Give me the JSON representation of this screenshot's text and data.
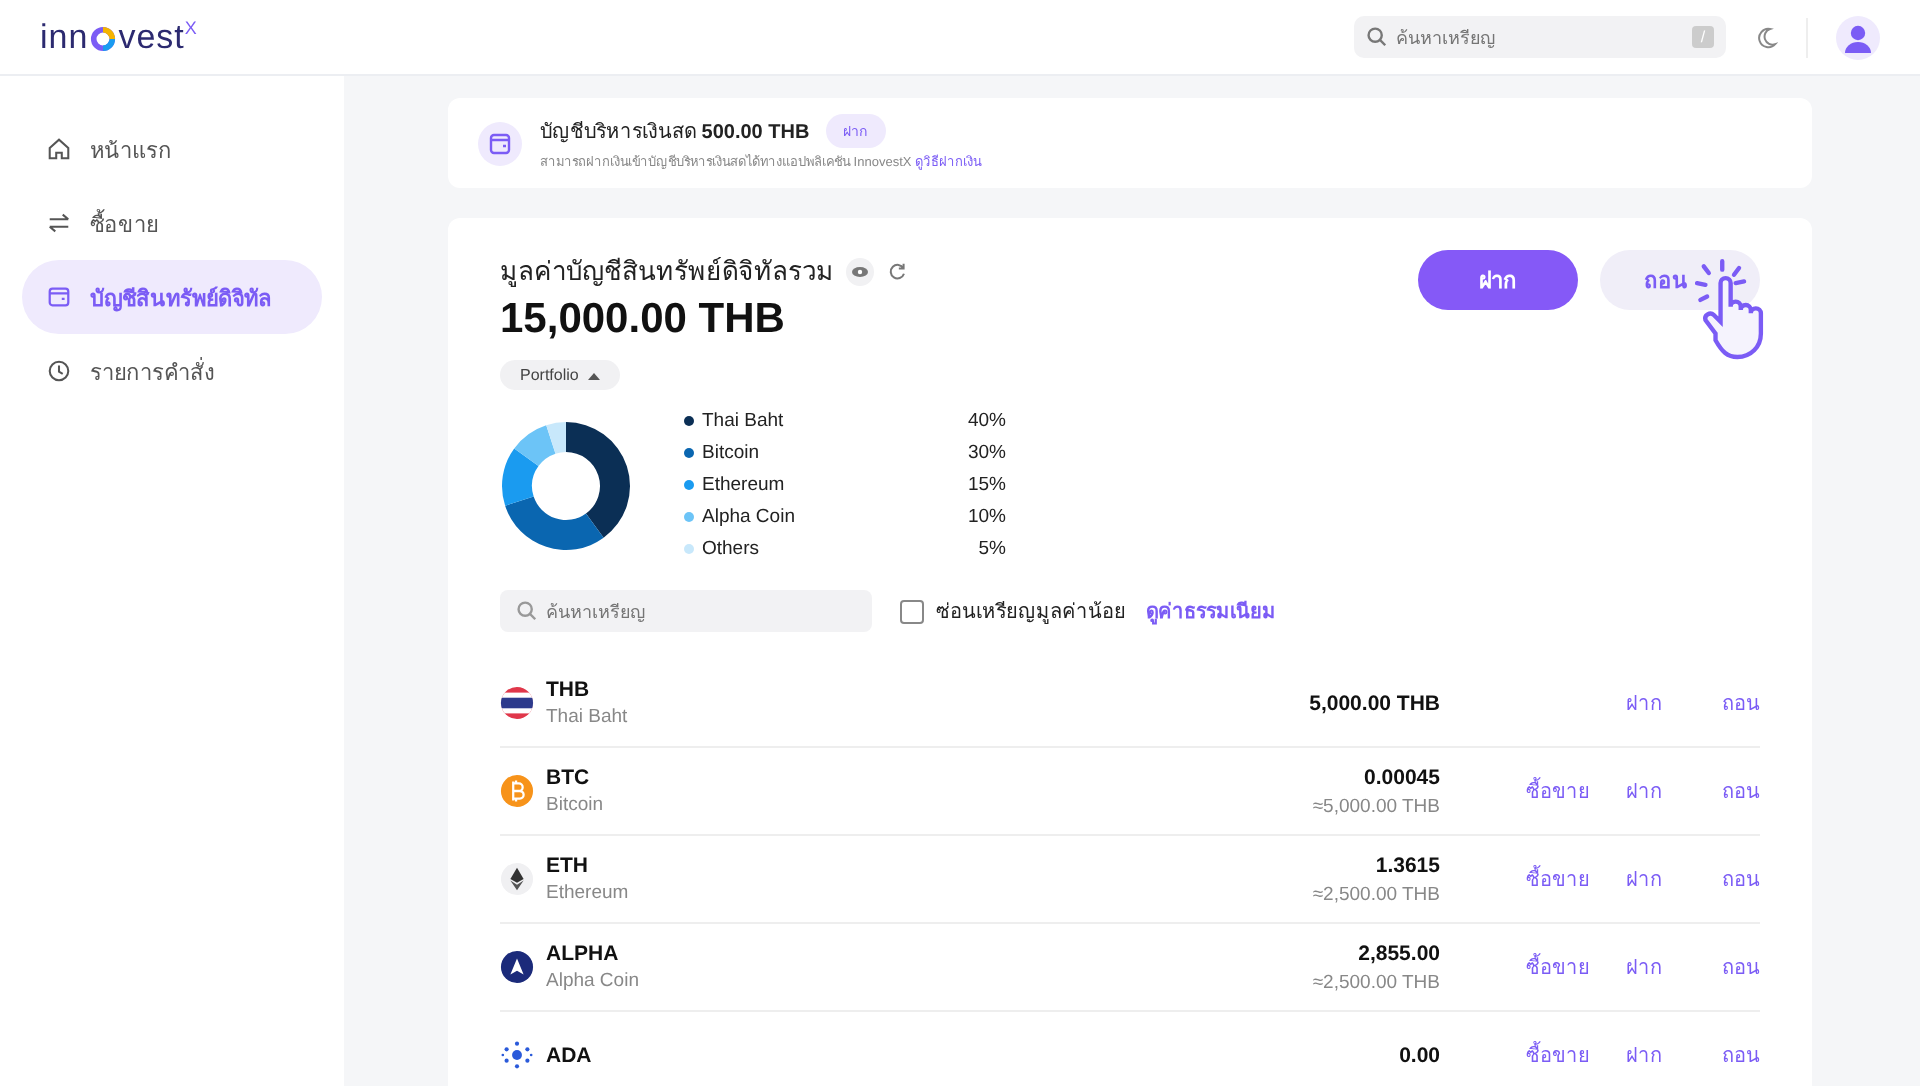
{
  "header": {
    "logo_parts": [
      "inn",
      "vest"
    ],
    "logo_sup": "X",
    "search": {
      "placeholder": "ค้นหาเหรียญ",
      "shortcut": "/"
    }
  },
  "sidebar": {
    "items": [
      {
        "label": "หน้าแรก",
        "kind": "home",
        "selected": false
      },
      {
        "label": "ซื้อขาย",
        "kind": "swap",
        "selected": false
      },
      {
        "label": "บัญชีสินทรัพย์ดิจิทัล",
        "kind": "wallet",
        "selected": true
      },
      {
        "label": "รายการคำสั่ง",
        "kind": "clock",
        "selected": false
      }
    ]
  },
  "cash_banner": {
    "title": "บัญชีบริหารเงินสด",
    "amount": "500.00 THB",
    "button": "ฝาก",
    "note": "สามารถฝากเงินเข้าบัญชีบริหารเงินสดได้ทางแอปพลิเคชัน InnovestX",
    "link": "ดูวิธีฝากเงิน"
  },
  "portfolio": {
    "title": "มูลค่าบัญชีสินทรัพย์ดิจิทัลรวม",
    "total": "15,000.00 THB",
    "dropdown": "Portfolio",
    "deposit_button": "ฝาก",
    "withdraw_button": "ถอน",
    "chart_data": {
      "type": "donut",
      "legend": "right",
      "categories": [
        "Thai Baht",
        "Bitcoin",
        "Ethereum",
        "Alpha Coin",
        "Others"
      ],
      "value_labels": [
        "40%",
        "30%",
        "15%",
        "10%",
        "5%"
      ],
      "series": [
        {
          "values": [
            40,
            30,
            15,
            10,
            5
          ],
          "colors": [
            "#0b2f55",
            "#0a66b0",
            "#1a9bf0",
            "#6cc4f7",
            "#c8e8fb"
          ]
        }
      ]
    },
    "coin_search": {
      "placeholder": "ค้นหาเหรียญ"
    },
    "hide_small": {
      "label": "ซ่อนเหรียญมูลค่าน้อย",
      "checked": false
    },
    "fee_link": "ดูค่าธรรมเนียม"
  },
  "assets": [
    {
      "symbol": "THB",
      "name": "Thai Baht",
      "kind": "thb",
      "amount": "5,000.00 THB",
      "actions": [
        {
          "kind": "deposit",
          "label": "ฝาก"
        },
        {
          "kind": "withdraw",
          "label": "ถอน"
        }
      ]
    },
    {
      "symbol": "BTC",
      "name": "Bitcoin",
      "kind": "btc",
      "amount": "0.00045",
      "value": "≈5,000.00 THB",
      "actions": [
        {
          "kind": "trade",
          "label": "ซื้อขาย"
        },
        {
          "kind": "deposit",
          "label": "ฝาก"
        },
        {
          "kind": "withdraw",
          "label": "ถอน"
        }
      ]
    },
    {
      "symbol": "ETH",
      "name": "Ethereum",
      "kind": "eth",
      "amount": "1.3615",
      "value": "≈2,500.00 THB",
      "actions": [
        {
          "kind": "trade",
          "label": "ซื้อขาย"
        },
        {
          "kind": "deposit",
          "label": "ฝาก"
        },
        {
          "kind": "withdraw",
          "label": "ถอน"
        }
      ]
    },
    {
      "symbol": "ALPHA",
      "name": "Alpha Coin",
      "kind": "alpha",
      "amount": "2,855.00",
      "value": "≈2,500.00 THB",
      "actions": [
        {
          "kind": "trade",
          "label": "ซื้อขาย"
        },
        {
          "kind": "deposit",
          "label": "ฝาก"
        },
        {
          "kind": "withdraw",
          "label": "ถอน"
        }
      ]
    },
    {
      "symbol": "ADA",
      "kind": "ada",
      "amount": "0.00",
      "actions": [
        {
          "kind": "trade",
          "label": "ซื้อขาย"
        },
        {
          "kind": "deposit",
          "label": "ฝาก"
        },
        {
          "kind": "withdraw",
          "label": "ถอน"
        }
      ]
    }
  ]
}
